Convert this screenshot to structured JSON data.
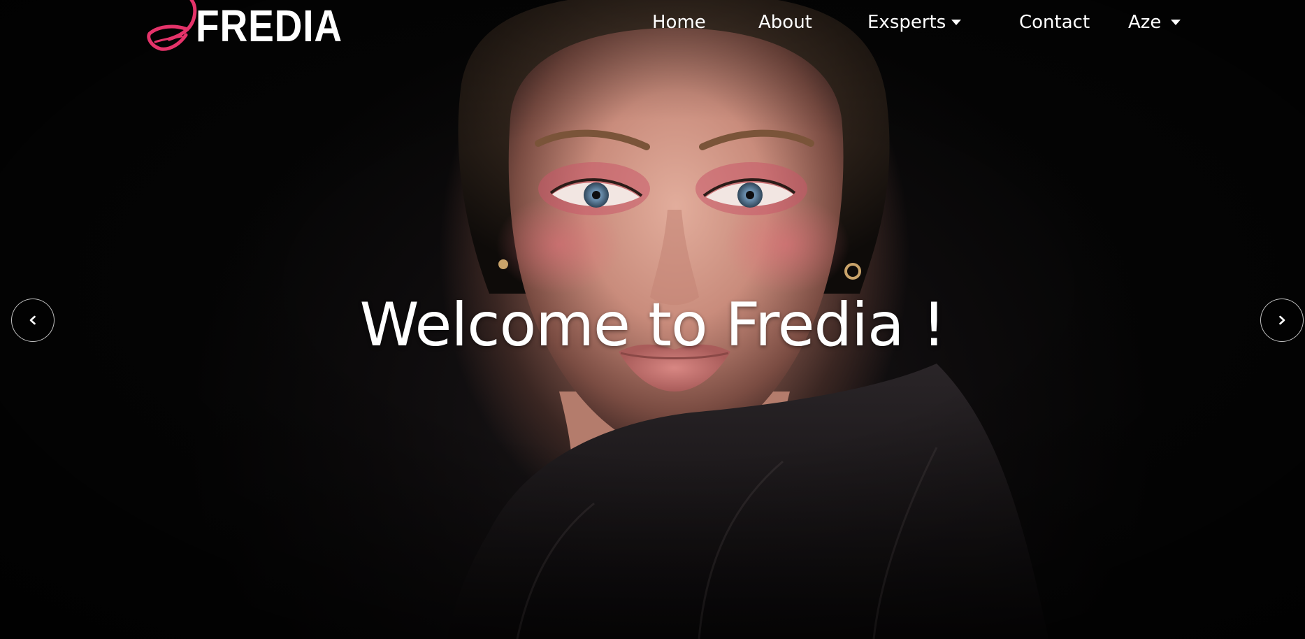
{
  "brand": {
    "name": "FREDIA",
    "accent_color": "#e5336a"
  },
  "nav": {
    "items": [
      {
        "label": "Home",
        "has_dropdown": false
      },
      {
        "label": "About",
        "has_dropdown": false
      },
      {
        "label": "Exsperts",
        "has_dropdown": true
      },
      {
        "label": "Contact",
        "has_dropdown": false
      },
      {
        "label": "Aze",
        "has_dropdown": true
      }
    ]
  },
  "hero": {
    "headline": "Welcome to Fredia !",
    "prev_icon": "chevron-left-icon",
    "next_icon": "chevron-right-icon"
  }
}
